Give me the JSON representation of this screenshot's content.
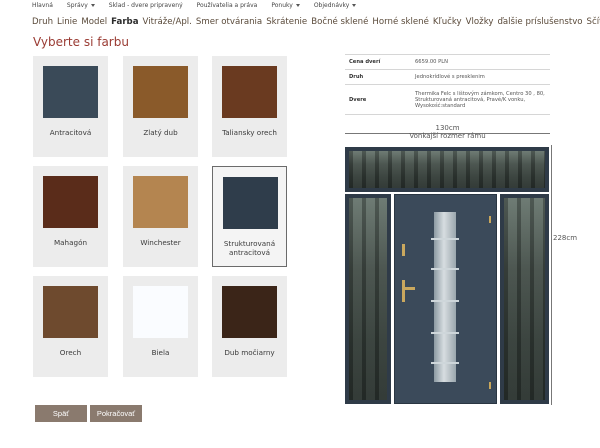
{
  "topnav": [
    {
      "label": "Hlavná",
      "dropdown": false
    },
    {
      "label": "Správy",
      "dropdown": true
    },
    {
      "label": "Sklad - dvere pripravený",
      "dropdown": false
    },
    {
      "label": "Používatelia a práva",
      "dropdown": false
    },
    {
      "label": "Ponuky",
      "dropdown": true
    },
    {
      "label": "Objednávky",
      "dropdown": true
    }
  ],
  "steps": [
    {
      "label": "Druh",
      "active": false
    },
    {
      "label": "Linie",
      "active": false
    },
    {
      "label": "Model",
      "active": false
    },
    {
      "label": "Farba",
      "active": true
    },
    {
      "label": "Vitráže/Apl.",
      "active": false
    },
    {
      "label": "Smer otvárania",
      "active": false
    },
    {
      "label": "Skrátenie",
      "active": false
    },
    {
      "label": "Bočné sklené",
      "active": false
    },
    {
      "label": "Horné sklené",
      "active": false
    },
    {
      "label": "Kľučky",
      "active": false
    },
    {
      "label": "Vložky",
      "active": false
    },
    {
      "label": "ďalšie príslušenstvo",
      "active": false
    },
    {
      "label": "Sčítanie",
      "active": false
    }
  ],
  "heading": "Vyberte si farbu",
  "colors": [
    {
      "label": "Antracitová",
      "swatch": "#3a4a58",
      "selected": false
    },
    {
      "label": "Zlatý dub",
      "swatch": "#8a5a2a",
      "selected": false
    },
    {
      "label": "Taliansky orech",
      "swatch": "#6a3a20",
      "selected": false
    },
    {
      "label": "Mahagón",
      "swatch": "#5a2c1a",
      "selected": false
    },
    {
      "label": "Winchester",
      "swatch": "#b48550",
      "selected": false
    },
    {
      "label": "Strukturovaná antracitová",
      "swatch": "#2f3d4b",
      "selected": true
    },
    {
      "label": "Orech",
      "swatch": "#6e4a2e",
      "selected": false
    },
    {
      "label": "Biela",
      "swatch": "#fafcff",
      "selected": false
    },
    {
      "label": "Dub močiarny",
      "swatch": "#3b2518",
      "selected": false
    }
  ],
  "buttons": {
    "back": "Späť",
    "next": "Pokračovať"
  },
  "summary": [
    {
      "label": "Cena dverí",
      "value": "6659.00 PLN"
    },
    {
      "label": "Druh",
      "value": "Jednokrídlové s presklenim"
    },
    {
      "label": "Dvere",
      "value": "Thermika Felc s lištovým zámkom, Centro 30 , 80, Strukturovaná antracitová, Pravé/K vonku, Wysokość:standard"
    }
  ],
  "dimensions": {
    "width": "130cm",
    "width_caption": "Vonkajší rozmer rámu",
    "height": "228cm"
  },
  "door_color": "#3b4a5a"
}
